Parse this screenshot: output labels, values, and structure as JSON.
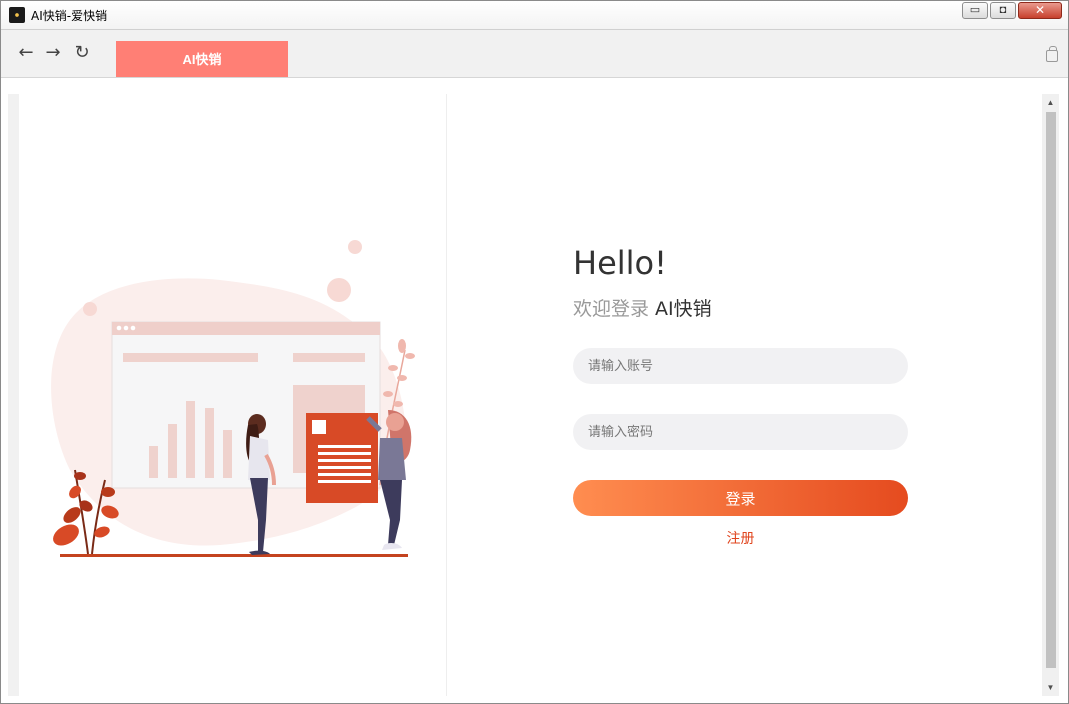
{
  "window": {
    "title": "AI快销-爱快销",
    "controls": {
      "minimize": "▭",
      "maximize": "◘",
      "close": "✕"
    }
  },
  "toolbar": {
    "back": "←",
    "forward": "→",
    "reload": "↻",
    "tab_label": "AI快销"
  },
  "login": {
    "hello": "Hello!",
    "welcome_prefix": "欢迎登录 ",
    "welcome_brand": "AI快销",
    "account_placeholder": "请输入账号",
    "password_placeholder": "请输入密码",
    "login_button": "登录",
    "register_link": "注册"
  },
  "colors": {
    "accent": "#e54b1f",
    "tab": "#ff7f75",
    "illustration_pink": "#f3c5be",
    "illustration_red": "#d84a26"
  },
  "icons": {
    "app": "app-icon",
    "extension": "extension-icon"
  },
  "scrollbar": {
    "up": "▲",
    "down": "▼"
  }
}
